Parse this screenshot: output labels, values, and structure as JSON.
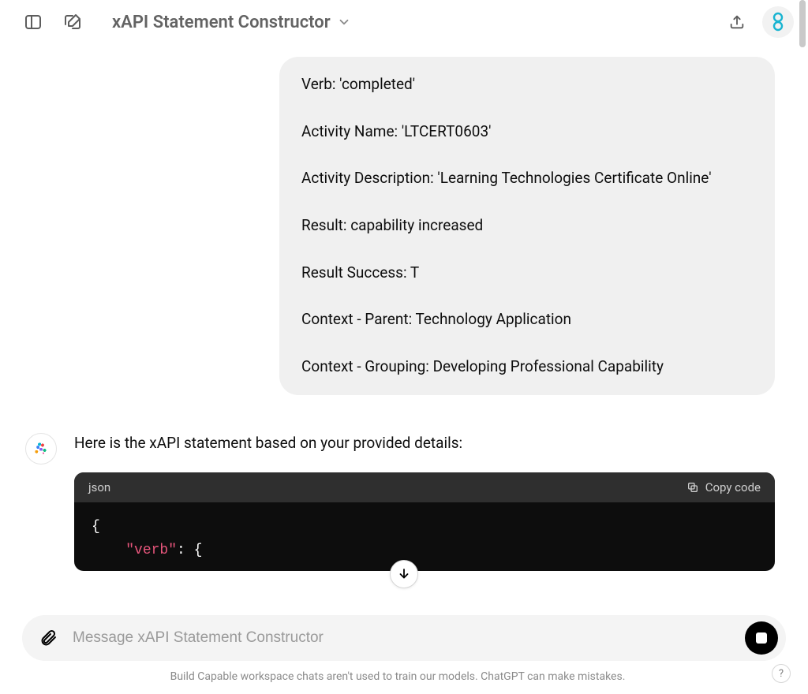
{
  "header": {
    "title": "xAPI Statement Constructor"
  },
  "user_message": {
    "lines": [
      "Verb: 'completed'",
      "Activity Name: 'LTCERT0603'",
      "Activity Description: 'Learning Technologies Certificate Online'",
      "Result: capability increased",
      "Result Success: T",
      "Context - Parent: Technology Application",
      "Context - Grouping: Developing Professional Capability"
    ]
  },
  "assistant": {
    "intro": "Here is the xAPI statement based on your provided details:"
  },
  "code": {
    "lang_label": "json",
    "copy_label": "Copy code",
    "line1": "{",
    "key_verb": "\"verb\"",
    "after_verb": ": {"
  },
  "composer": {
    "placeholder": "Message xAPI Statement Constructor"
  },
  "footer": {
    "note": "Build Capable workspace chats aren't used to train our models. ChatGPT can make mistakes."
  },
  "help": {
    "label": "?"
  }
}
